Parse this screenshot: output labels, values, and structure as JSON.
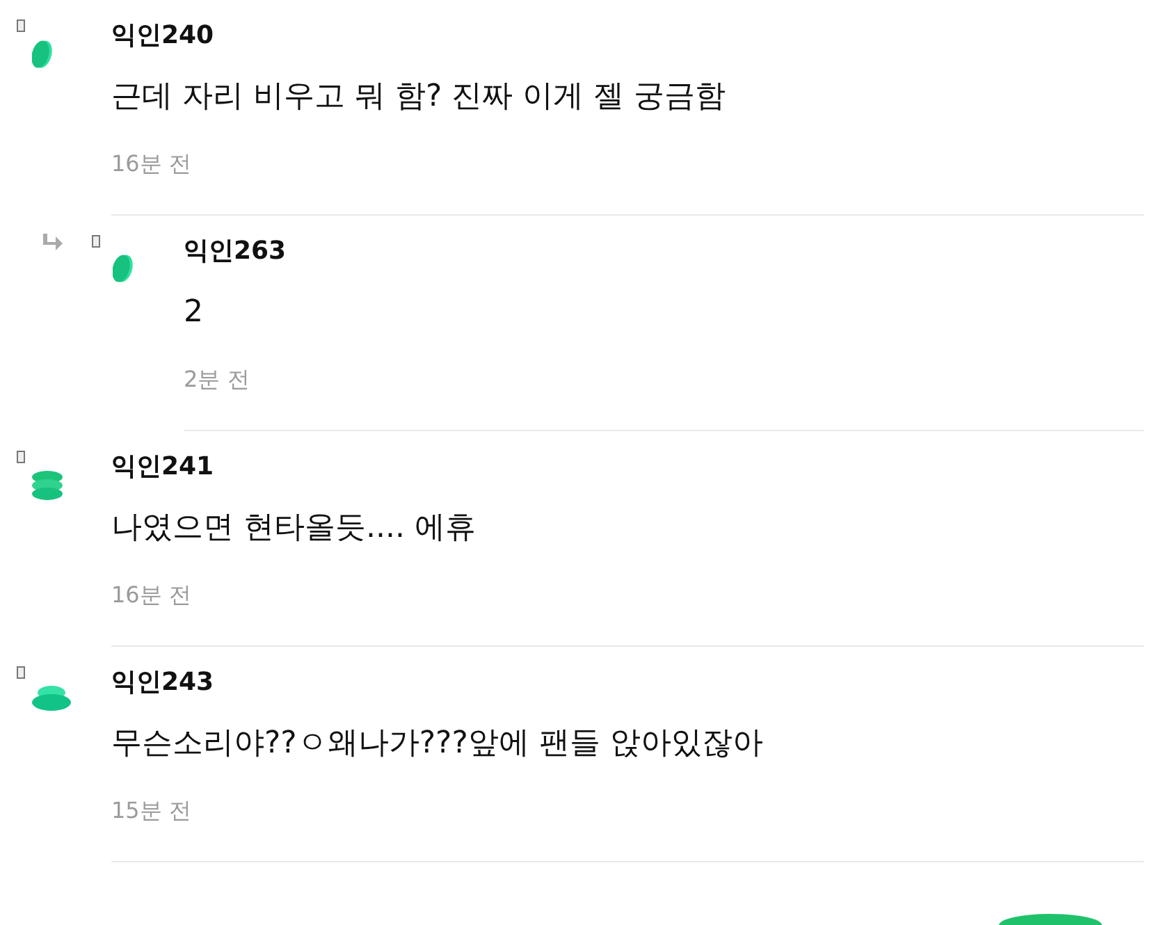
{
  "comments": [
    {
      "author": "익인240",
      "text": "근데 자리 비우고 뭐 함? 진짜 이게 젤 궁금함",
      "time": "16분 전",
      "kind": "single",
      "children": [
        {
          "author": "익인263",
          "text": "2",
          "time": "2분 전",
          "kind": "single"
        }
      ]
    },
    {
      "author": "익인241",
      "text": "나였으면 현타올듯.... 에휴",
      "time": "16분 전",
      "kind": "stack3"
    },
    {
      "author": "익인243",
      "text": "무슨소리야??ㅇ왜나가???앞에 팬들 앉아있잖아",
      "time": "15분 전",
      "kind": "stack2"
    }
  ],
  "floating_button": {
    "kind": "round"
  }
}
